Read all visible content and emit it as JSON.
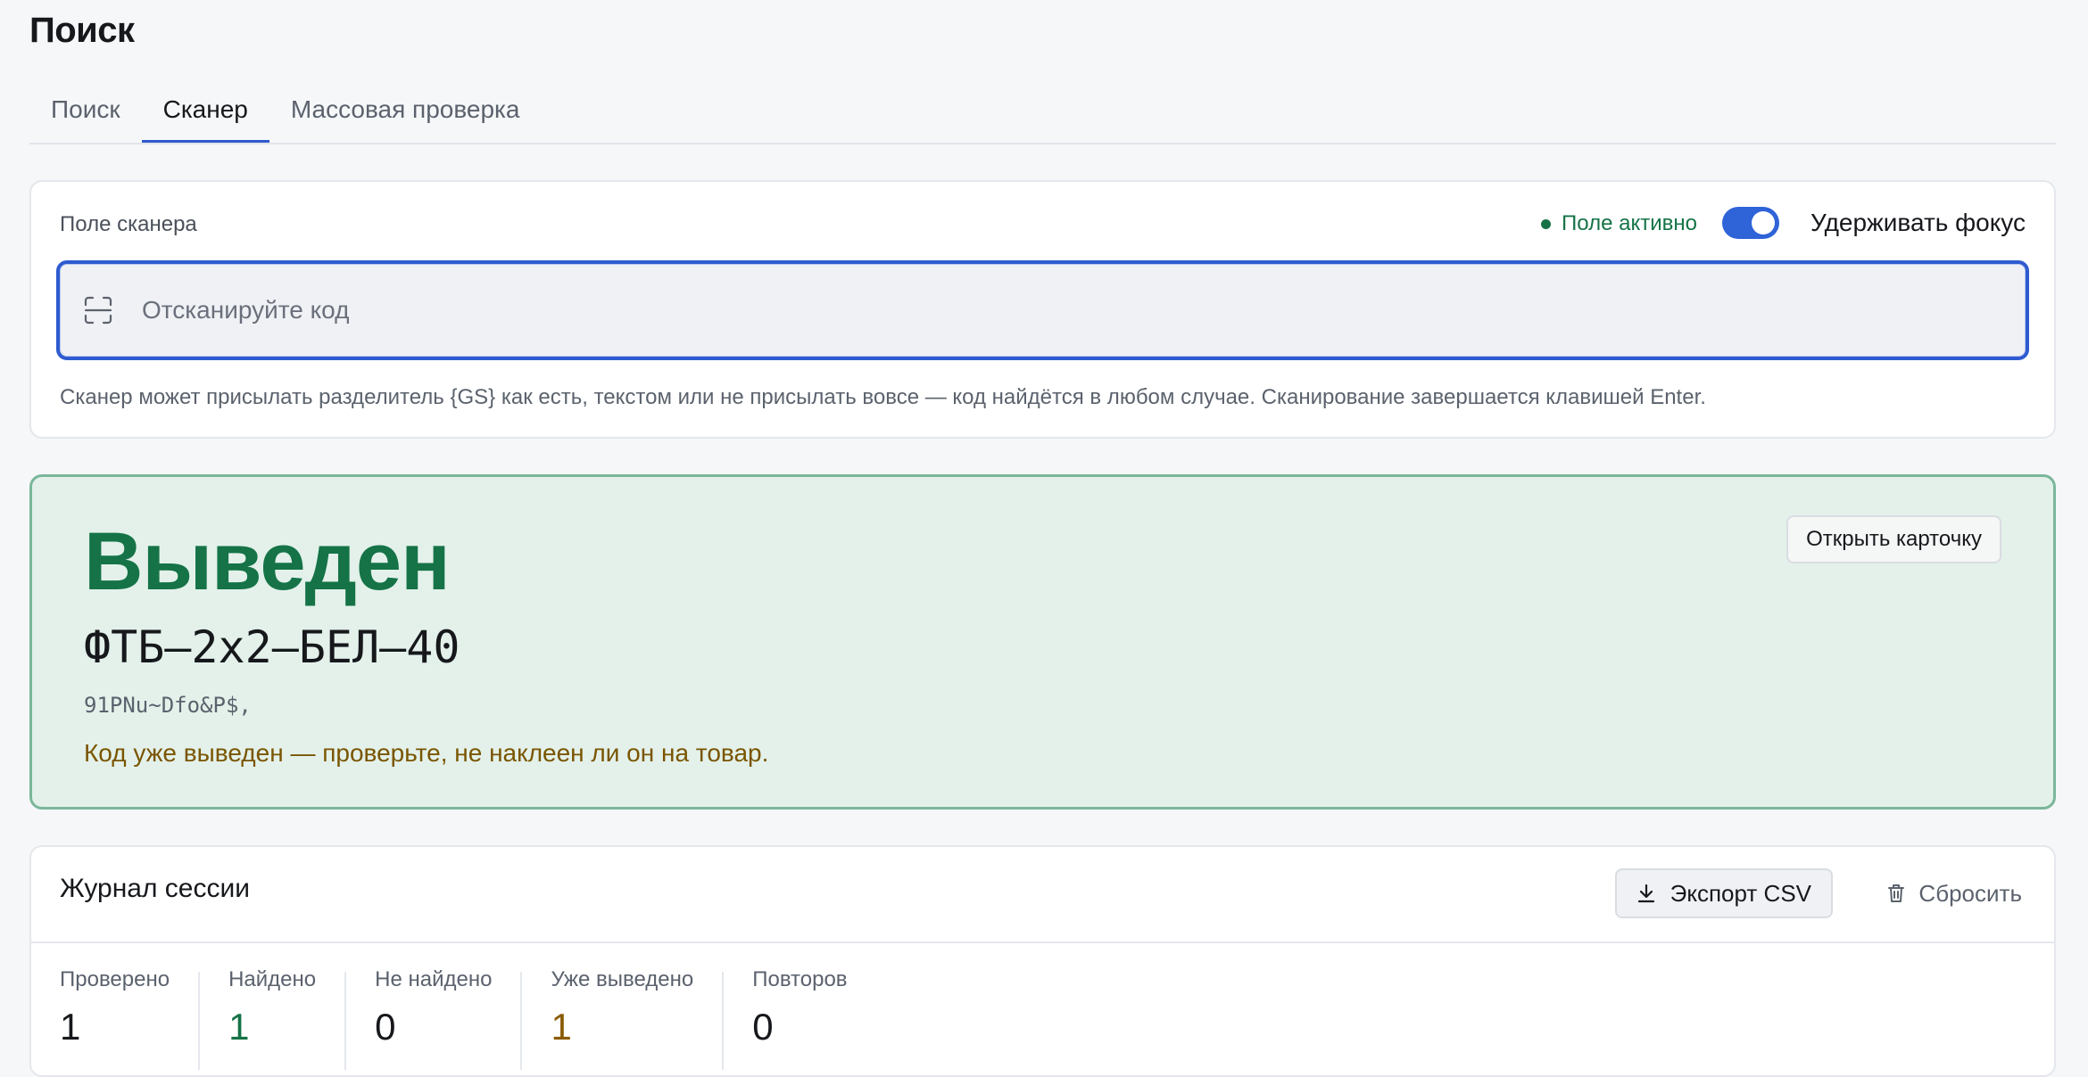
{
  "page": {
    "title": "Поиск"
  },
  "tabs": [
    {
      "label": "Поиск"
    },
    {
      "label": "Сканер"
    },
    {
      "label": "Массовая проверка"
    }
  ],
  "scanner": {
    "label": "Поле сканера",
    "status": "Поле активно",
    "keep_focus_label": "Удерживать фокус",
    "keep_focus_on": true,
    "placeholder": "Отсканируйте код",
    "value": "",
    "hint": "Сканер может присылать разделитель {GS} как есть, текстом или не присылать вовсе — код найдётся в любом случае. Сканирование завершается клавишей Enter."
  },
  "result": {
    "status": "Выведен",
    "sku": "ФТБ–2x2–БЕЛ–40",
    "code": "91PNu~Dfo&P$,",
    "warning": "Код уже выведен — проверьте, не наклеен ли он на товар.",
    "open_button": "Открыть карточку"
  },
  "log": {
    "title": "Журнал сессии",
    "export_label": "Экспорт CSV",
    "reset_label": "Сбросить",
    "stats": [
      {
        "label": "Проверено",
        "value": "1"
      },
      {
        "label": "Найдено",
        "value": "1"
      },
      {
        "label": "Не найдено",
        "value": "0"
      },
      {
        "label": "Уже выведено",
        "value": "1"
      },
      {
        "label": "Повторов",
        "value": "0"
      }
    ]
  },
  "colors": {
    "accent": "#2f5bd0",
    "success": "#157347",
    "warning": "#8a5a00",
    "result_bg": "#e3f1ea"
  }
}
